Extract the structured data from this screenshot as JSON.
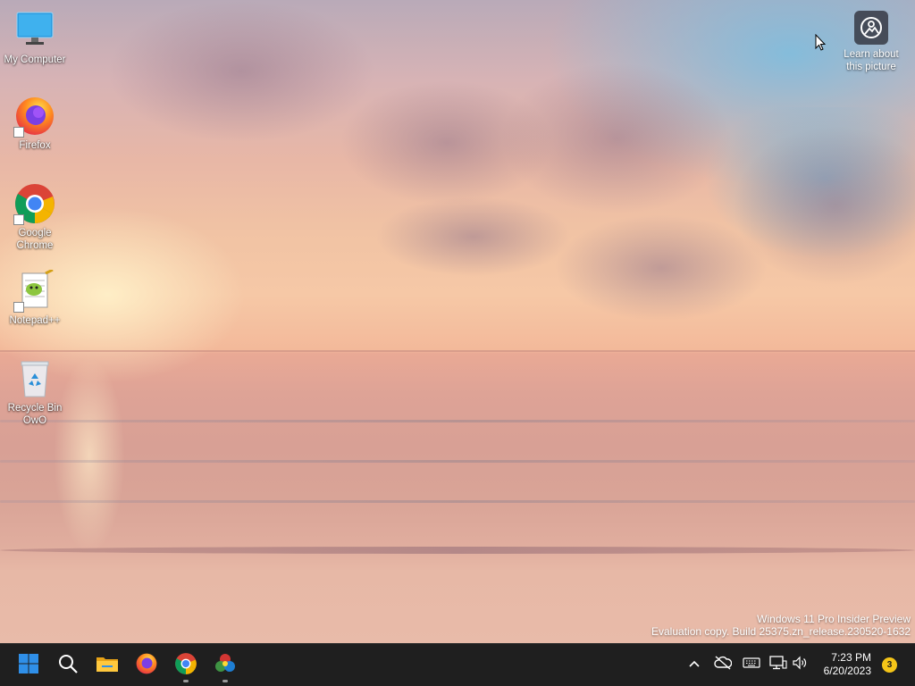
{
  "desktop": {
    "icons": [
      {
        "label": "My Computer",
        "icon": "monitor-icon"
      },
      {
        "label": "Firefox",
        "icon": "firefox-icon"
      },
      {
        "label": "Google Chrome",
        "icon": "chrome-icon"
      },
      {
        "label": "Notepad++",
        "icon": "notepadpp-icon"
      },
      {
        "label": "Recycle Bin OwO",
        "icon": "recycle-bin-icon"
      }
    ],
    "learn_about": {
      "label": "Learn about this picture",
      "icon": "camera-icon"
    },
    "watermark": {
      "line1": "Windows 11 Pro Insider Preview",
      "line2": "Evaluation copy. Build 25375.zn_release.230520-1632"
    }
  },
  "taskbar": {
    "items": [
      {
        "name": "start",
        "icon": "windows-start-icon"
      },
      {
        "name": "search",
        "icon": "search-icon"
      },
      {
        "name": "file-explorer",
        "icon": "folder-icon"
      },
      {
        "name": "firefox",
        "icon": "firefox-icon"
      },
      {
        "name": "chrome",
        "icon": "chrome-icon",
        "running": true
      },
      {
        "name": "color-app",
        "icon": "color-wheel-icon",
        "running": true
      }
    ],
    "tray": {
      "icons": [
        "chevron-up-icon",
        "cloud-offline-icon",
        "keyboard-icon",
        "network-icon",
        "speaker-icon"
      ],
      "time": "7:23 PM",
      "date": "6/20/2023",
      "notification_count": "3"
    }
  },
  "colors": {
    "taskbar_bg": "#1f1f1f",
    "windows_blue": "#2f8fe8",
    "badge_yellow": "#f5c518"
  }
}
